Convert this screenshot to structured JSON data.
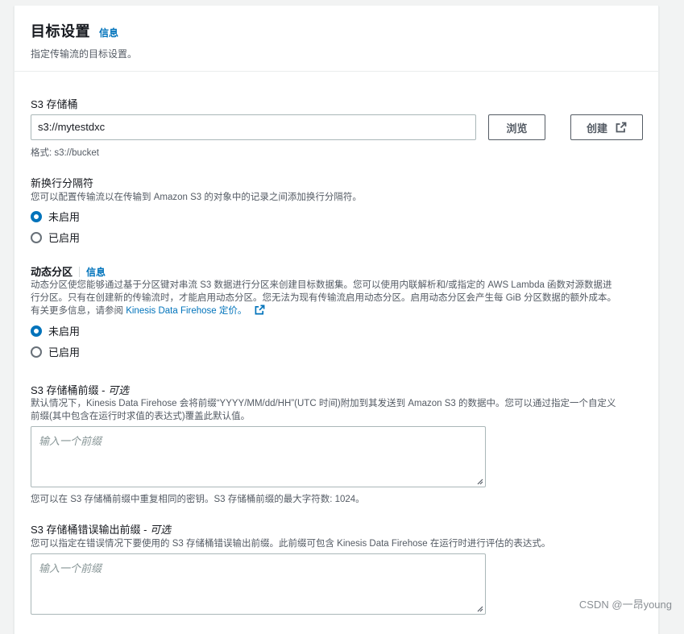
{
  "header": {
    "title": "目标设置",
    "info": "信息",
    "description": "指定传输流的目标设置。"
  },
  "s3_bucket": {
    "label": "S3 存储桶",
    "value": "s3://mytestdxc",
    "browse_label": "浏览",
    "create_label": "创建",
    "format_hint": "格式: s3://bucket"
  },
  "newline": {
    "label": "新换行分隔符",
    "description": "您可以配置传输流以在传输到 Amazon S3 的对象中的记录之间添加换行分隔符。",
    "options": [
      "未启用",
      "已启用"
    ],
    "selected": "未启用"
  },
  "dynamic_partition": {
    "label": "动态分区",
    "info": "信息",
    "description_1": "动态分区使您能够通过基于分区键对串流 S3 数据进行分区来创建目标数据集。您可以使用内联解析和/或指定的 AWS Lambda 函数对源数据进",
    "description_2": "行分区。只有在创建新的传输流时，才能启用动态分区。您无法为现有传输流启用动态分区。启用动态分区会产生每 GiB 分区数据的额外成本。",
    "description_3": "有关更多信息，请参阅",
    "pricing_link": "Kinesis Data Firehose 定价。",
    "options": [
      "未启用",
      "已启用"
    ],
    "selected": "未启用"
  },
  "prefix": {
    "label": "S3 存储桶前缀 - ",
    "optional": "可选",
    "description_1": "默认情况下，Kinesis Data Firehose 会将前缀“YYYY/MM/dd/HH”(UTC 时间)附加到其发送到 Amazon S3 的数据中。您可以通过指定一个自定义",
    "description_2": "前缀(其中包含在运行时求值的表达式)覆盖此默认值。",
    "placeholder": "输入一个前缀",
    "hint": "您可以在 S3 存储桶前缀中重复相同的密钥。S3 存储桶前缀的最大字符数: 1024。"
  },
  "error_prefix": {
    "label": "S3 存储桶错误输出前缀 - ",
    "optional": "可选",
    "description": "您可以指定在错误情况下要使用的 S3 存储桶错误输出前缀。此前缀可包含 Kinesis Data Firehose 在运行时进行评估的表达式。",
    "placeholder": "输入一个前缀"
  },
  "watermark": "CSDN @一昂young",
  "colors": {
    "accent": "#0073bb",
    "text": "#16191f",
    "secondary_text": "#545b64",
    "border": "#aab7b8"
  }
}
